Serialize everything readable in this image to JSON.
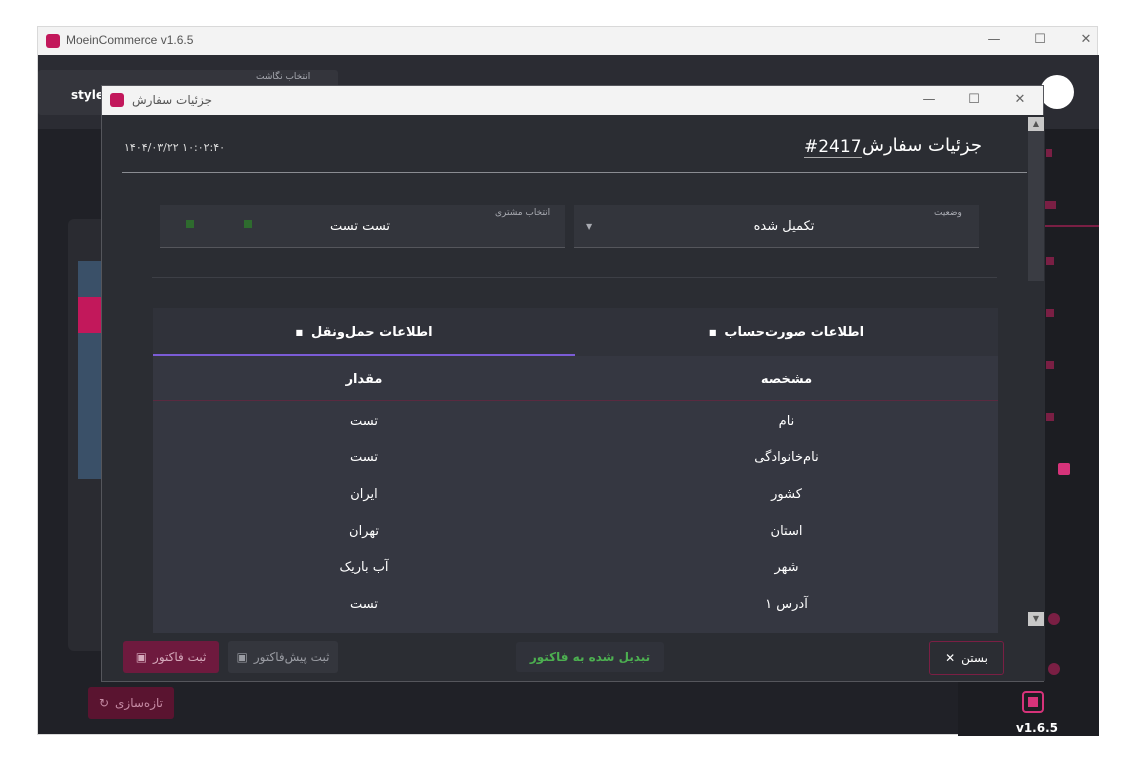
{
  "main_window": {
    "title": "MoeinCommerce v1.6.5",
    "controls": [
      "—",
      "☐",
      "✕"
    ],
    "top_left_label_small": "انتخاب نگاشت",
    "top_left_label": "style",
    "bg_refresh_label": "تازه‌سازی",
    "version": "v1.6.5"
  },
  "dialog": {
    "title": "جزئیات سفارش",
    "controls": [
      "—",
      "☐",
      "✕"
    ],
    "header_title": "جزئیات سفارش",
    "order_number": "#2417",
    "timestamp": "۱۴۰۴/۰۳/۲۲ ۱۰:۰۲:۴۰",
    "status_label": "وضعیت",
    "status_value": "تکمیل شده",
    "customer_label": "انتخاب مشتری",
    "customer_value": "تست تست",
    "tabs": [
      {
        "label": "اطلاعات صورت‌حساب",
        "active": false
      },
      {
        "label": "اطلاعات حمل‌ونقل",
        "active": true
      }
    ],
    "table": {
      "headers": {
        "property": "مشخصه",
        "value": "مقدار"
      },
      "rows": [
        {
          "property": "نام",
          "value": "تست"
        },
        {
          "property": "نام‌خانوادگی",
          "value": "تست"
        },
        {
          "property": "کشور",
          "value": "ایران"
        },
        {
          "property": "استان",
          "value": "تهران"
        },
        {
          "property": "شهر",
          "value": "آب باریک"
        },
        {
          "property": "آدرس ۱",
          "value": "تست"
        }
      ]
    },
    "footer": {
      "close_label": "بستن",
      "converted_label": "تبدیل شده به فاکتور",
      "preinvoice_label": "ثبت پیش‌فاکتور",
      "invoice_label": "ثبت فاکتور"
    }
  },
  "colors": {
    "accent": "#d6337a",
    "tab_underline": "#7b5cd6",
    "converted_text": "#4caf50"
  }
}
